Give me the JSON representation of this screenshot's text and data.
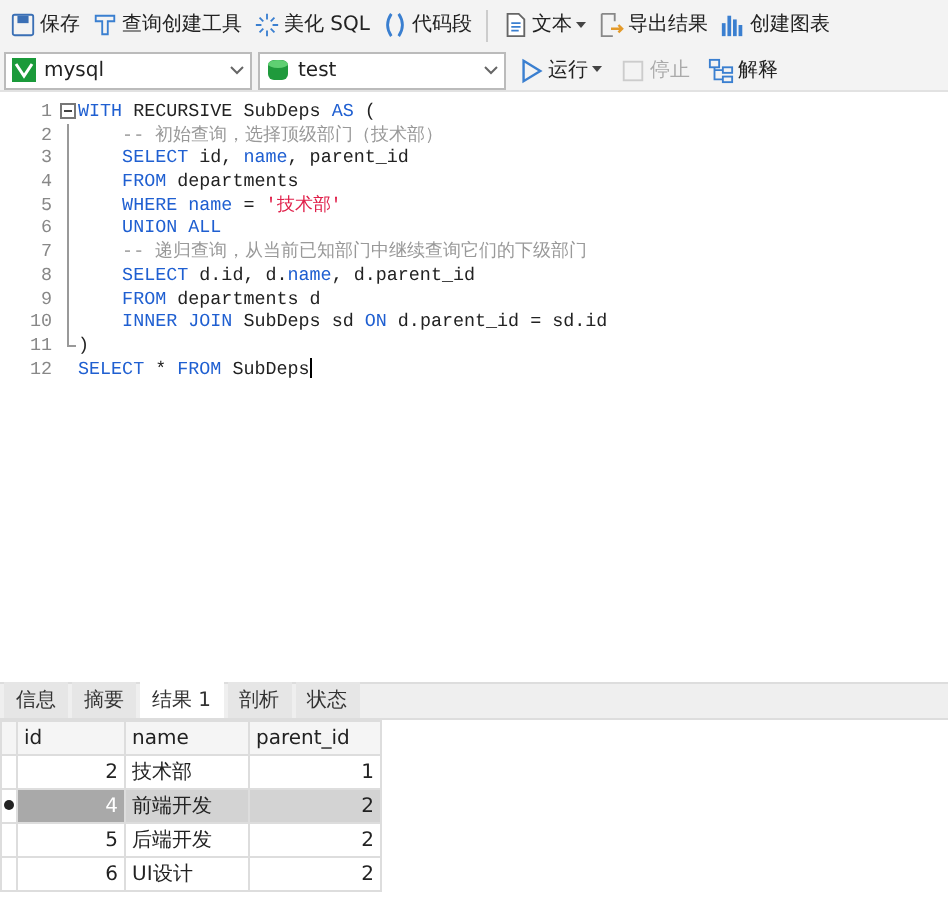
{
  "toolbar": [
    {
      "kind": "button",
      "label": "保存",
      "dropdown": false
    },
    {
      "kind": "button",
      "label": "查询创建工具",
      "dropdown": false
    },
    {
      "kind": "button",
      "label": "美化 SQL",
      "dropdown": false
    },
    {
      "kind": "button",
      "label": "代码段",
      "dropdown": false
    },
    {
      "kind": "separator"
    },
    {
      "kind": "button",
      "label": "文本",
      "dropdown": true
    },
    {
      "kind": "button",
      "label": "导出结果",
      "dropdown": false
    },
    {
      "kind": "button",
      "label": "创建图表",
      "dropdown": false
    }
  ],
  "connection": {
    "value": "mysql"
  },
  "database": {
    "value": "test"
  },
  "actions": [
    {
      "label": "运行",
      "dropdown": true,
      "disabled": false
    },
    {
      "label": "停止",
      "dropdown": false,
      "disabled": true
    },
    {
      "label": "解释",
      "dropdown": false,
      "disabled": false
    }
  ],
  "editor": {
    "fold": {
      "expanded": true
    },
    "lines": [
      {
        "number": "1",
        "cursor": false,
        "tokens": [
          {
            "kind": "keyword",
            "text": "WITH"
          },
          {
            "kind": "plain",
            "text": " RECURSIVE SubDeps "
          },
          {
            "kind": "keyword",
            "text": "AS"
          },
          {
            "kind": "plain",
            "text": " ("
          }
        ]
      },
      {
        "number": "2",
        "cursor": false,
        "tokens": [
          {
            "kind": "comment",
            "text": "    -- 初始查询，选择顶级部门（技术部）"
          }
        ]
      },
      {
        "number": "3",
        "cursor": false,
        "tokens": [
          {
            "kind": "keyword",
            "text": "    SELECT"
          },
          {
            "kind": "plain",
            "text": " id, "
          },
          {
            "kind": "keyword",
            "text": "name"
          },
          {
            "kind": "plain",
            "text": ", parent_id"
          }
        ]
      },
      {
        "number": "4",
        "cursor": false,
        "tokens": [
          {
            "kind": "keyword",
            "text": "    FROM"
          },
          {
            "kind": "plain",
            "text": " departments"
          }
        ]
      },
      {
        "number": "5",
        "cursor": false,
        "tokens": [
          {
            "kind": "keyword",
            "text": "    WHERE name"
          },
          {
            "kind": "plain",
            "text": " = "
          },
          {
            "kind": "string",
            "text": "'技术部'"
          }
        ]
      },
      {
        "number": "6",
        "cursor": false,
        "tokens": [
          {
            "kind": "keyword",
            "text": "    UNION ALL"
          }
        ]
      },
      {
        "number": "7",
        "cursor": false,
        "tokens": [
          {
            "kind": "comment",
            "text": "    -- 递归查询，从当前已知部门中继续查询它们的下级部门"
          }
        ]
      },
      {
        "number": "8",
        "cursor": false,
        "tokens": [
          {
            "kind": "keyword",
            "text": "    SELECT"
          },
          {
            "kind": "plain",
            "text": " d.id, d."
          },
          {
            "kind": "keyword",
            "text": "name"
          },
          {
            "kind": "plain",
            "text": ", d.parent_id"
          }
        ]
      },
      {
        "number": "9",
        "cursor": false,
        "tokens": [
          {
            "kind": "keyword",
            "text": "    FROM"
          },
          {
            "kind": "plain",
            "text": " departments d"
          }
        ]
      },
      {
        "number": "10",
        "cursor": false,
        "tokens": [
          {
            "kind": "keyword",
            "text": "    INNER JOIN"
          },
          {
            "kind": "plain",
            "text": " SubDeps sd "
          },
          {
            "kind": "keyword",
            "text": "ON"
          },
          {
            "kind": "plain",
            "text": " d.parent_id = sd.id"
          }
        ]
      },
      {
        "number": "11",
        "cursor": false,
        "tokens": [
          {
            "kind": "plain",
            "text": ")"
          }
        ]
      },
      {
        "number": "12",
        "cursor": true,
        "tokens": [
          {
            "kind": "keyword",
            "text": "SELECT"
          },
          {
            "kind": "plain",
            "text": " * "
          },
          {
            "kind": "keyword",
            "text": "FROM"
          },
          {
            "kind": "plain",
            "text": " SubDeps"
          }
        ]
      }
    ]
  },
  "result_tabs": [
    {
      "label": "信息",
      "selected": false
    },
    {
      "label": "摘要",
      "selected": false
    },
    {
      "label": "结果 1",
      "selected": true
    },
    {
      "label": "剖析",
      "selected": false
    },
    {
      "label": "状态",
      "selected": false
    }
  ],
  "table": {
    "columns": [
      "id",
      "name",
      "parent_id"
    ],
    "rows": [
      {
        "selected": false,
        "cells": [
          "2",
          "技术部",
          "1"
        ]
      },
      {
        "selected": true,
        "cells": [
          "4",
          "前端开发",
          "2"
        ]
      },
      {
        "selected": false,
        "cells": [
          "5",
          "后端开发",
          "2"
        ]
      },
      {
        "selected": false,
        "cells": [
          "6",
          "UI设计",
          "2"
        ]
      }
    ]
  }
}
